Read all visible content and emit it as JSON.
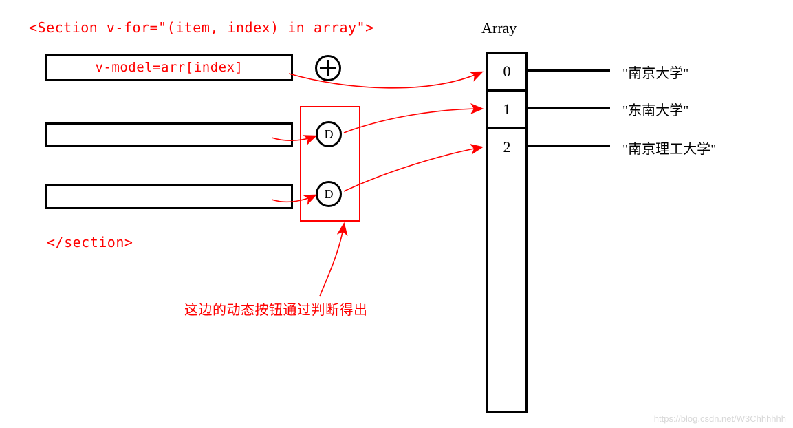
{
  "diagram": {
    "section_open": "<Section v-for=\"(item, index) in array\">",
    "section_close": "</section>",
    "vmodel_label": "v-model=arr[index]",
    "d_label_1": "D",
    "d_label_2": "D",
    "dynamic_button_note": "这边的动态按钮通过判断得出",
    "array_title": "Array",
    "array_indices": [
      "0",
      "1",
      "2"
    ],
    "array_values": [
      "\"南京大学\"",
      "\"东南大学\"",
      "\"南京理工大学\""
    ],
    "watermark": "https://blog.csdn.net/W3Chhhhhh"
  }
}
